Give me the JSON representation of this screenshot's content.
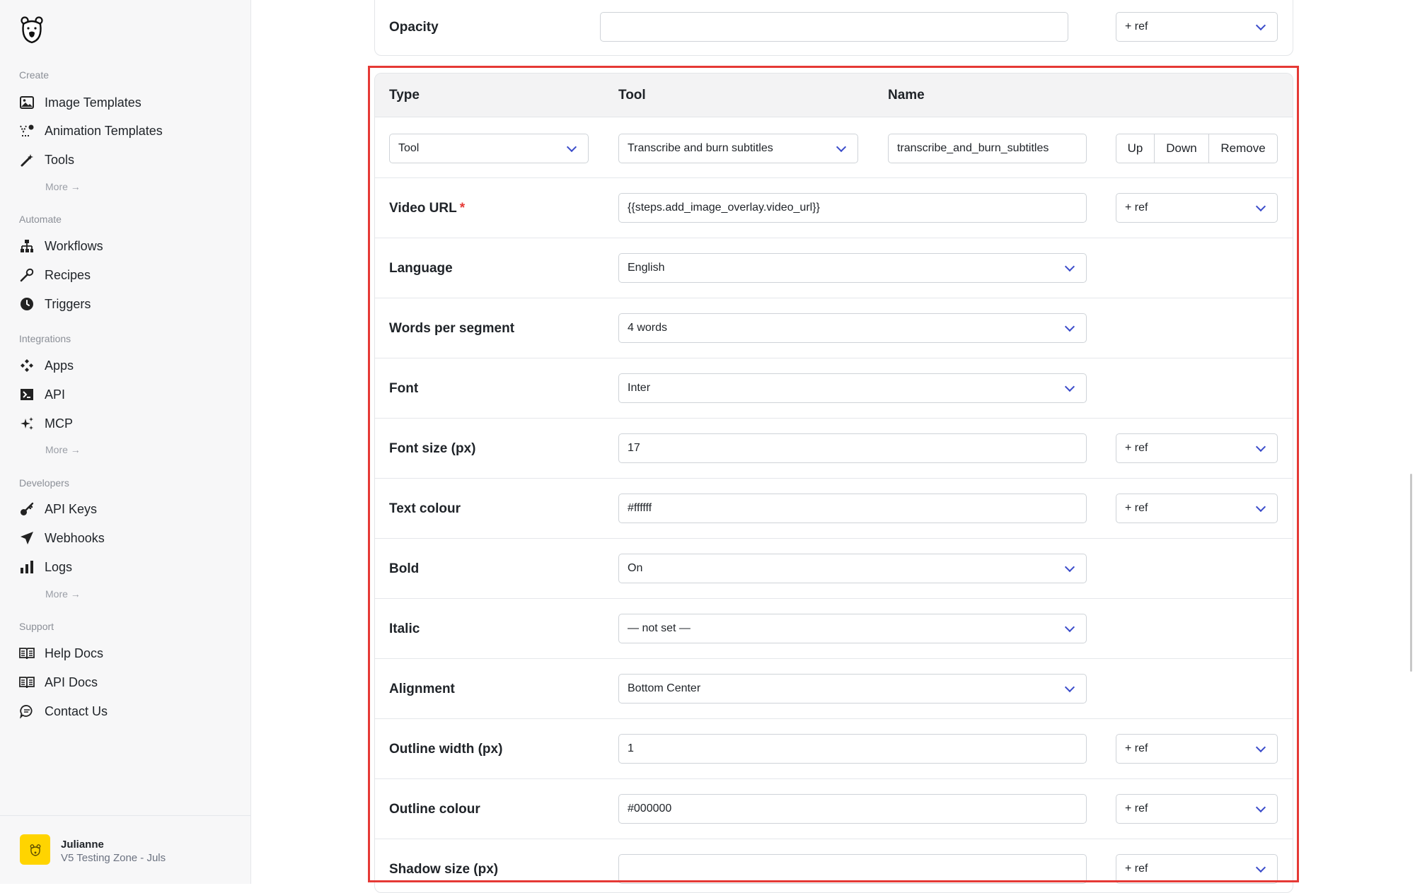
{
  "sidebar": {
    "sections": {
      "create": "Create",
      "automate": "Automate",
      "integrations": "Integrations",
      "developers": "Developers",
      "support": "Support"
    },
    "items": {
      "image_templates": "Image Templates",
      "animation_templates": "Animation Templates",
      "tools": "Tools",
      "workflows": "Workflows",
      "recipes": "Recipes",
      "triggers": "Triggers",
      "apps": "Apps",
      "api": "API",
      "mcp": "MCP",
      "api_keys": "API Keys",
      "webhooks": "Webhooks",
      "logs": "Logs",
      "help_docs": "Help Docs",
      "api_docs": "API Docs",
      "contact_us": "Contact Us"
    },
    "more": "More →",
    "user": {
      "name": "Julianne",
      "zone": "V5 Testing Zone - Juls"
    }
  },
  "top_row": {
    "label": "Opacity",
    "value": "",
    "ref": "+ ref"
  },
  "step": {
    "headers": {
      "type": "Type",
      "tool": "Tool",
      "name": "Name"
    },
    "type_value": "Tool",
    "tool_value": "Transcribe and burn subtitles",
    "name_value": "transcribe_and_burn_subtitles",
    "buttons": {
      "up": "Up",
      "down": "Down",
      "remove": "Remove"
    },
    "ref_label": "+ ref",
    "required_mark": "*",
    "fields": {
      "video_url": {
        "label": "Video URL",
        "value": "{{steps.add_image_overlay.video_url}}"
      },
      "language": {
        "label": "Language",
        "value": "English"
      },
      "words_per_segment": {
        "label": "Words per segment",
        "value": "4 words"
      },
      "font": {
        "label": "Font",
        "value": "Inter"
      },
      "font_size": {
        "label": "Font size (px)",
        "value": "17"
      },
      "text_colour": {
        "label": "Text colour",
        "value": "#ffffff"
      },
      "bold": {
        "label": "Bold",
        "value": "On"
      },
      "italic": {
        "label": "Italic",
        "value": "— not set —"
      },
      "alignment": {
        "label": "Alignment",
        "value": "Bottom Center"
      },
      "outline_width": {
        "label": "Outline width (px)",
        "value": "1"
      },
      "outline_colour": {
        "label": "Outline colour",
        "value": "#000000"
      },
      "shadow_size": {
        "label": "Shadow size (px)",
        "value": ""
      }
    }
  },
  "colors": {
    "highlight": "#e53935",
    "accent": "#3b4cca",
    "avatar": "#ffd400"
  }
}
